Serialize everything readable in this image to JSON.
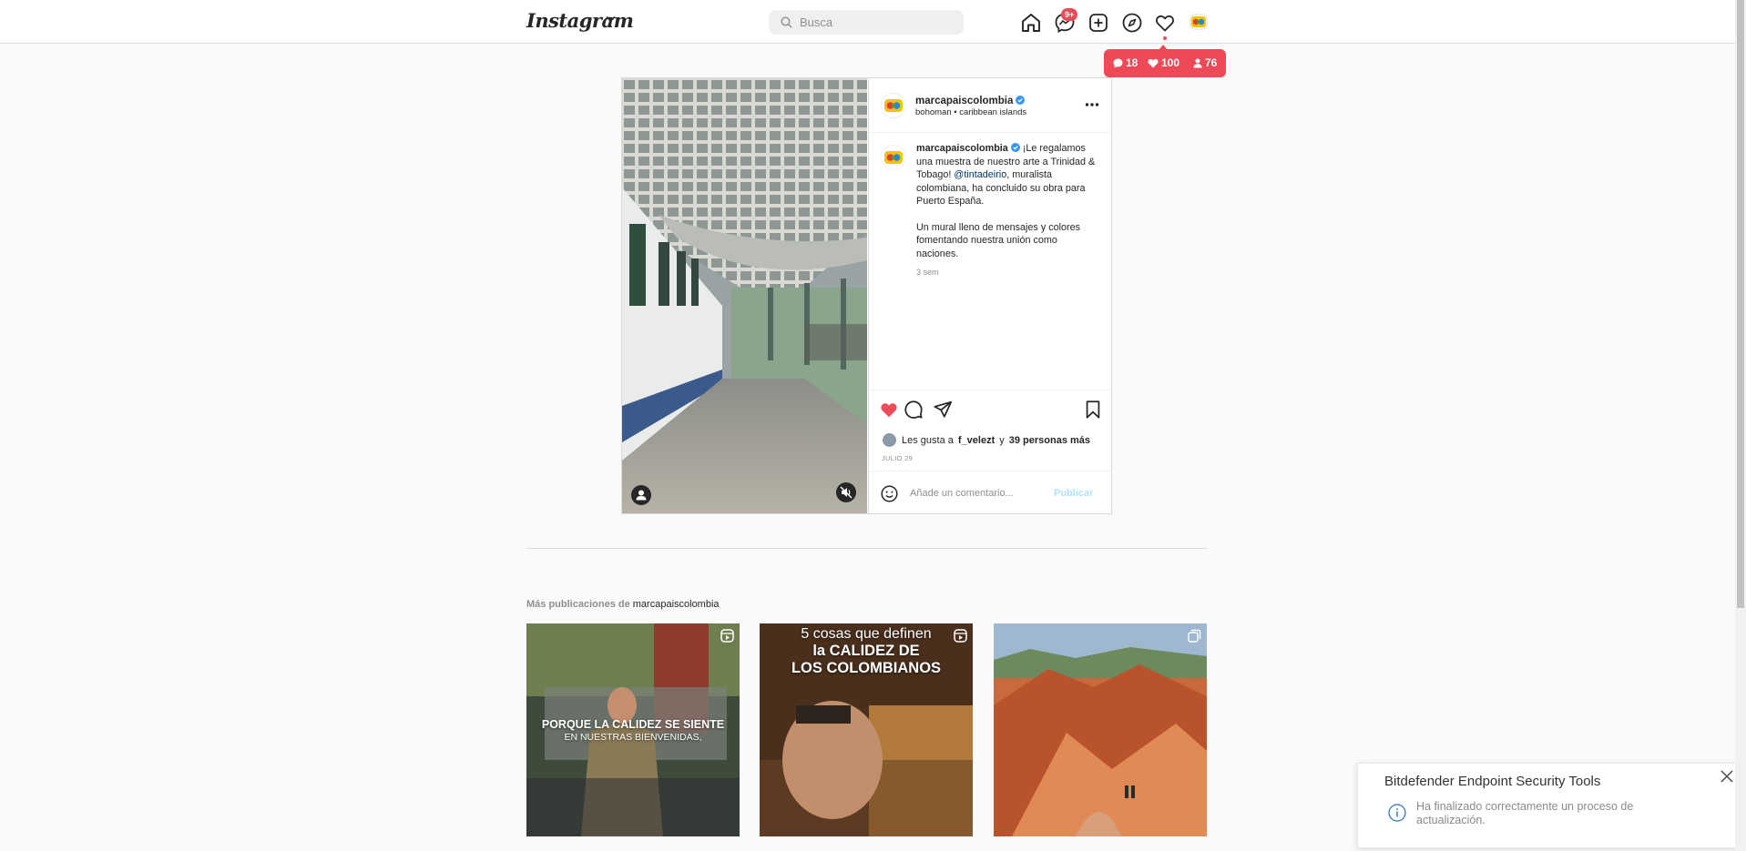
{
  "app": {
    "logo": "Instagram"
  },
  "search": {
    "placeholder": "Busca"
  },
  "nav": {
    "icons": [
      "home-icon",
      "messenger-icon",
      "new-post-icon",
      "explore-icon",
      "activity-heart-icon",
      "profile-avatar"
    ],
    "messages_badge": "9+"
  },
  "notifications": {
    "comments": "18",
    "likes": "100",
    "followers": "76"
  },
  "post": {
    "username": "marcapaiscolombia",
    "location": "bohoman • caribbean islands",
    "caption_user": "marcapaiscolombia",
    "caption_text_1": "¡Le regalamos una muestra de nuestro arte a Trinidad & Tobago! ",
    "caption_mention": "@tintadeirio",
    "caption_text_2": ", muralista colombiana, ha concluido su obra para Puerto España.",
    "caption_text_3": "Un mural lleno de mensajes y colores fomentando nuestra unión como naciones.",
    "caption_time": "3 sem",
    "likes_prefix": "Les gusta a",
    "likes_user": "f_velezt",
    "likes_and": "y",
    "likes_others": "39 personas más",
    "date": "JULIO 29",
    "liked": true,
    "comment_placeholder": "Añade un comentario...",
    "publish_label": "Publicar"
  },
  "more_posts": {
    "heading_prefix": "Más publicaciones de",
    "heading_user": "marcapaiscolombia",
    "items": [
      {
        "type": "reel",
        "text_line1": "PORQUE LA CALIDEZ SE SIENTE",
        "text_line2": "EN NUESTRAS BIENVENIDAS,"
      },
      {
        "type": "reel",
        "text_line1": "5 cosas que definen",
        "text_line2": "la CALIDEZ DE",
        "text_line3": "LOS COLOMBIANOS"
      },
      {
        "type": "carousel"
      }
    ]
  },
  "toast": {
    "title": "Bitdefender Endpoint Security Tools",
    "message": "Ha finalizado correctamente un proceso de actualización."
  },
  "colors": {
    "accent_red": "#ed4956",
    "link_blue": "#0095f6",
    "verified_blue": "#3897f0"
  }
}
